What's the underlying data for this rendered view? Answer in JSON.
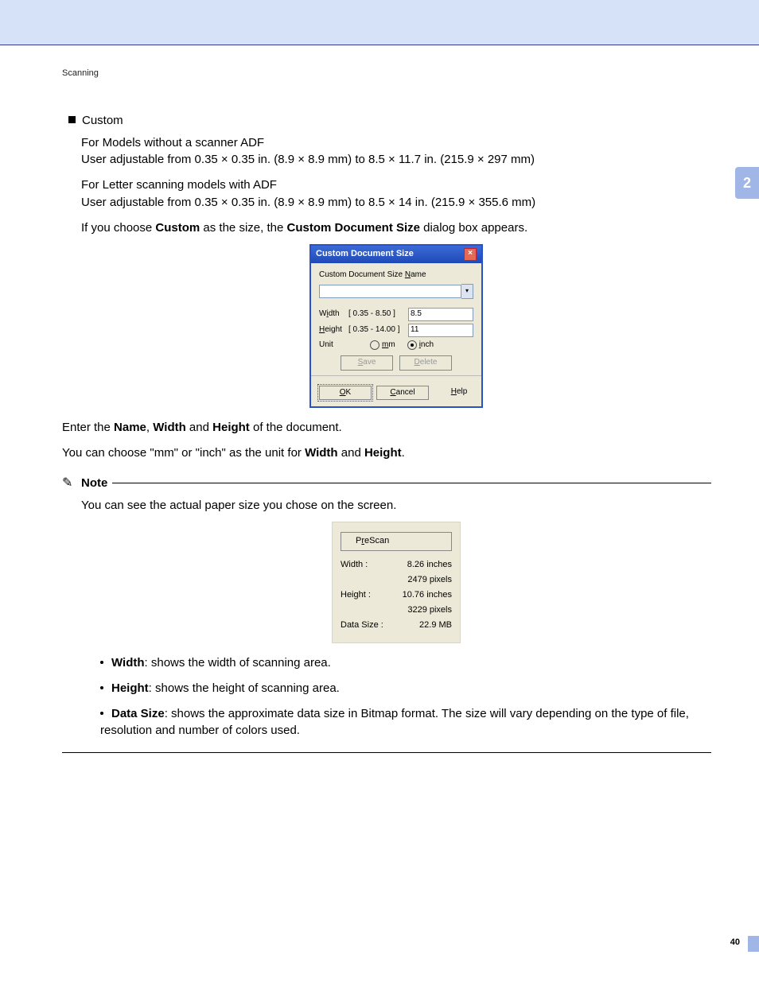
{
  "header": {
    "section": "Scanning"
  },
  "sideTab": "2",
  "pageNumber": "40",
  "custom": {
    "title": "Custom",
    "noADF_l1": "For Models without a scanner ADF",
    "noADF_l2": "User adjustable from 0.35 × 0.35 in. (8.9 × 8.9 mm) to 8.5 × 11.7 in. (215.9 × 297 mm)",
    "adf_l1": "For Letter scanning models with ADF",
    "adf_l2": "User adjustable from 0.35 × 0.35 in. (8.9 × 8.9 mm) to 8.5 × 14 in. (215.9 × 355.6 mm)",
    "choose_pre": "If you choose ",
    "choose_b1": "Custom",
    "choose_mid": " as the size, the ",
    "choose_b2": "Custom Document Size",
    "choose_post": " dialog box appears."
  },
  "dialog": {
    "title": "Custom Document Size",
    "nameLabel": "Custom Document Size Name",
    "nameValue": "",
    "width": {
      "label_pre": "W",
      "label_u": "i",
      "label_post": "dth",
      "range": "[  0.35  -  8.50  ]",
      "value": "8.5"
    },
    "height": {
      "label_u": "H",
      "label_post": "eight",
      "range": "[  0.35  - 14.00  ]",
      "value": "11"
    },
    "unit": {
      "label": "Unit",
      "mm_u": "m",
      "mm_post": "m",
      "inch_u": "i",
      "inch_post": "nch"
    },
    "save_u": "S",
    "save_post": "ave",
    "delete_u": "D",
    "delete_post": "elete",
    "ok_u": "O",
    "ok_post": "K",
    "cancel_u": "C",
    "cancel_post": "ancel",
    "help_u": "H",
    "help_post": "elp"
  },
  "afterDialog": {
    "p1_pre": "Enter the ",
    "p1_b1": "Name",
    "p1_m1": ", ",
    "p1_b2": "Width",
    "p1_m2": " and ",
    "p1_b3": "Height",
    "p1_post": " of the document.",
    "p2_pre": "You can choose \"mm\" or \"inch\" as the unit for ",
    "p2_b1": "Width",
    "p2_m": " and ",
    "p2_b2": "Height",
    "p2_post": "."
  },
  "note": {
    "label": "Note",
    "body": "You can see the actual paper size you chose on the screen."
  },
  "prescan": {
    "btn_pre": "P",
    "btn_u": "r",
    "btn_post": "eScan",
    "width_l": "Width :",
    "width_v": "8.26 inches",
    "width_px": "2479 pixels",
    "height_l": "Height :",
    "height_v": "10.76 inches",
    "height_px": "3229 pixels",
    "data_l": "Data Size :",
    "data_v": "22.9 MB"
  },
  "defs": {
    "w_b": "Width",
    "w_t": ": shows the width of scanning area.",
    "h_b": "Height",
    "h_t": ": shows the height of scanning area.",
    "d_b": "Data Size",
    "d_t": ": shows the approximate data size in Bitmap format. The size will vary depending on the type of file, resolution and number of colors used."
  }
}
